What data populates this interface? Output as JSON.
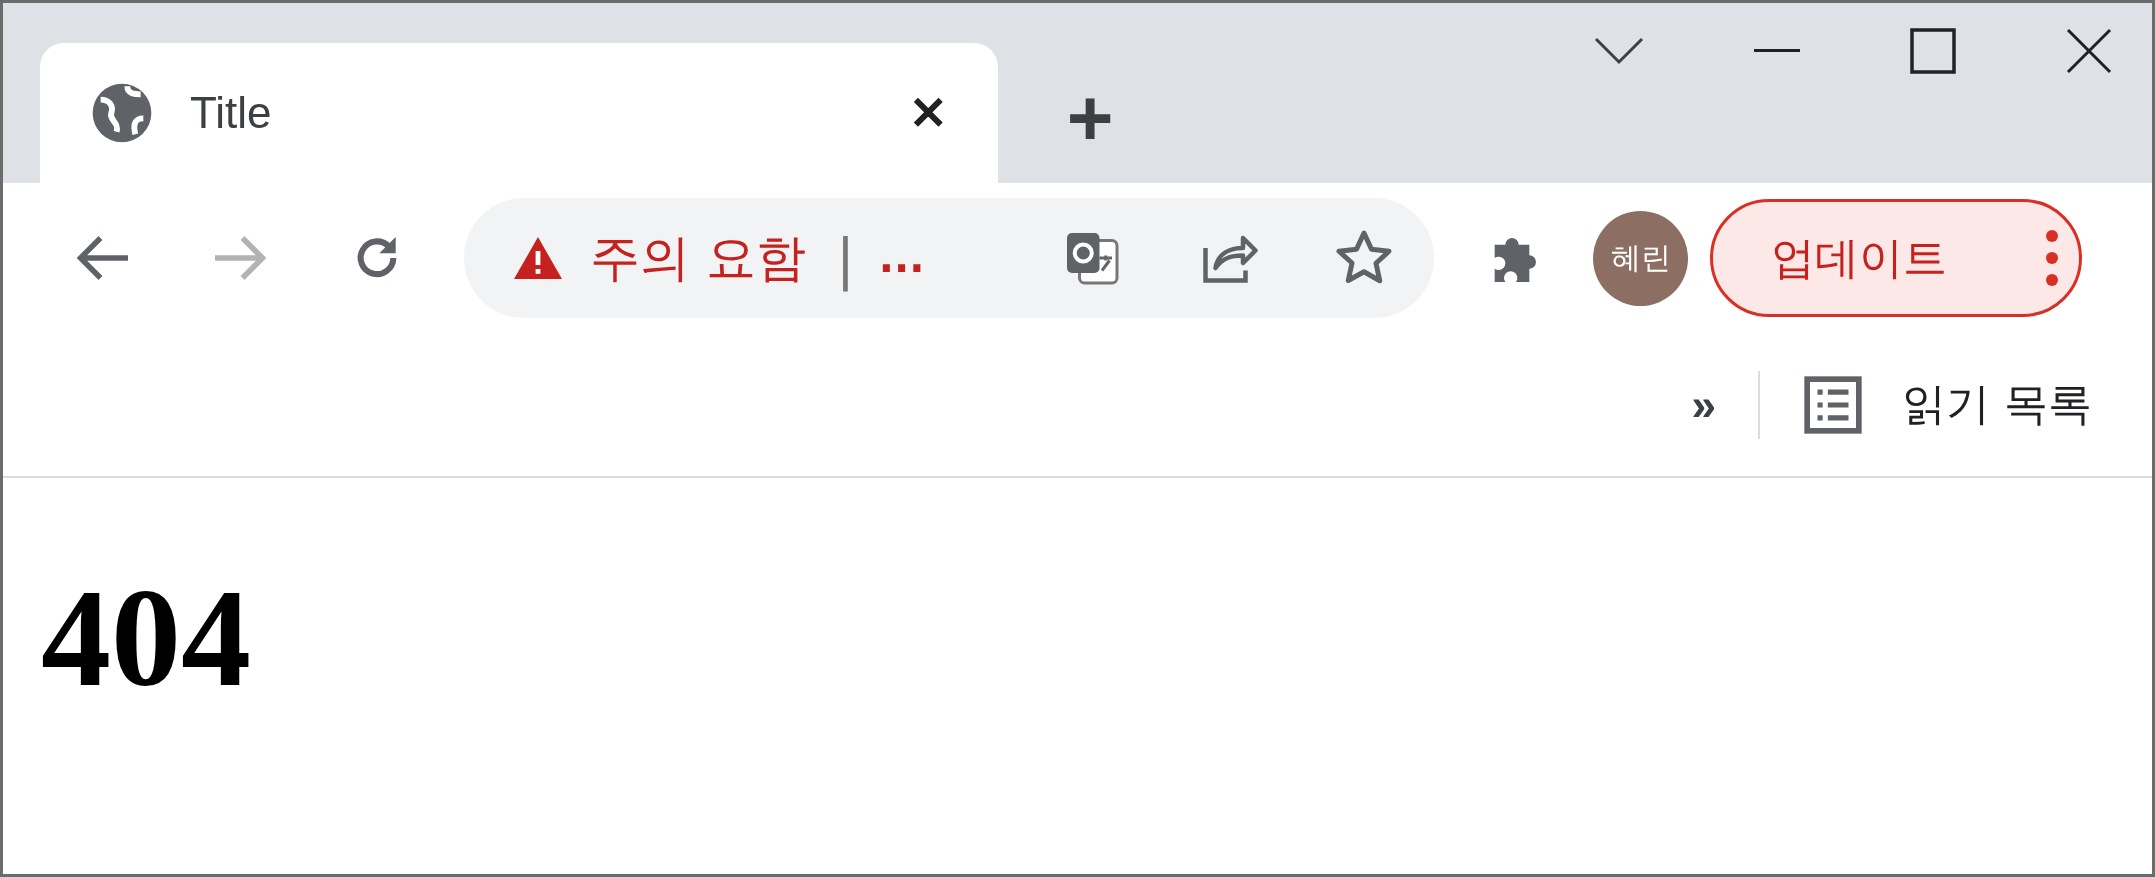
{
  "tabs": [
    {
      "title": "Title",
      "close": "✕",
      "selected": true
    }
  ],
  "new_tab": "+",
  "nav_buttons": [
    {
      "kind": "back",
      "disabled": false
    },
    {
      "kind": "forward",
      "disabled": true
    },
    {
      "kind": "reload",
      "disabled": false
    }
  ],
  "address_bar": {
    "security_label": "주의 요함",
    "separator": "|",
    "url": "..."
  },
  "profile": {
    "initials": "혜린"
  },
  "update_button": {
    "label": "업데이트"
  },
  "bookmarks_bar": {
    "overflow": "»",
    "reading_list": "읽기 목록"
  },
  "page": {
    "heading": "404"
  }
}
